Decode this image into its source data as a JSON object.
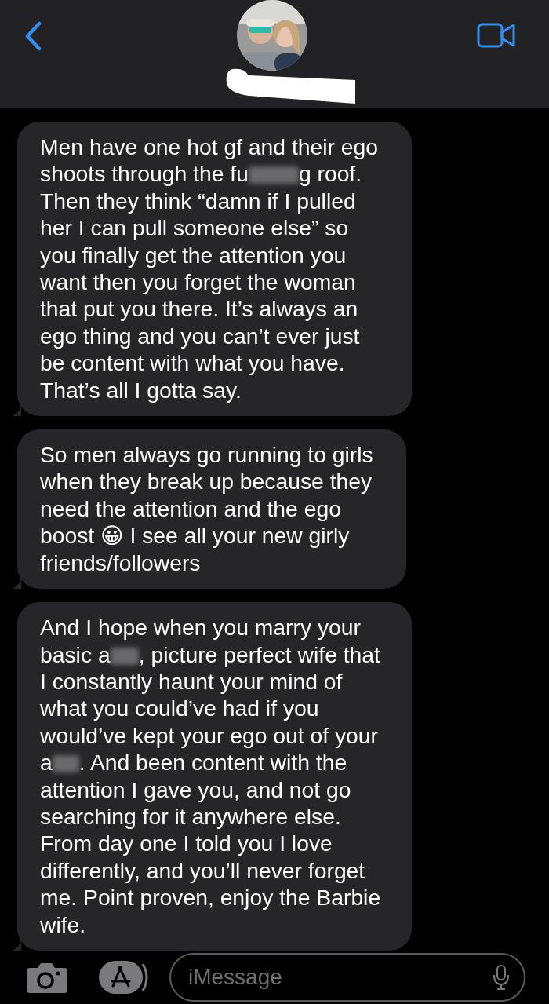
{
  "messages": [
    {
      "segments": [
        {
          "kind": "text",
          "text": "Men have one hot gf and their ego shoots through the fu"
        },
        {
          "kind": "censor"
        },
        {
          "kind": "text",
          "text": "g roof. Then they think “damn if I pulled her I can pull someone else” so you finally get the attention you want then you forget the woman that put you there. It’s always an ego thing and you can’t ever just be content with what you have. That’s all I gotta say."
        }
      ]
    },
    {
      "segments": [
        {
          "kind": "text",
          "text": "So men always go running to girls when they break up because they need the attention and the ego boost 😀 I see all your new girly friends/followers"
        }
      ]
    },
    {
      "segments": [
        {
          "kind": "text",
          "text": "And I hope when you marry your basic a"
        },
        {
          "kind": "censor"
        },
        {
          "kind": "text",
          "text": ", picture perfect wife that I constantly haunt your mind of what you could’ve had if you would’ve kept your ego out of your a"
        },
        {
          "kind": "censor"
        },
        {
          "kind": "text",
          "text": ". And been content with the attention I gave you, and not go searching for it anywhere else. From day one I told you I love differently, and you’ll never forget me. Point proven, enjoy the Barbie wife."
        }
      ]
    }
  ],
  "composer": {
    "placeholder": "iMessage"
  }
}
